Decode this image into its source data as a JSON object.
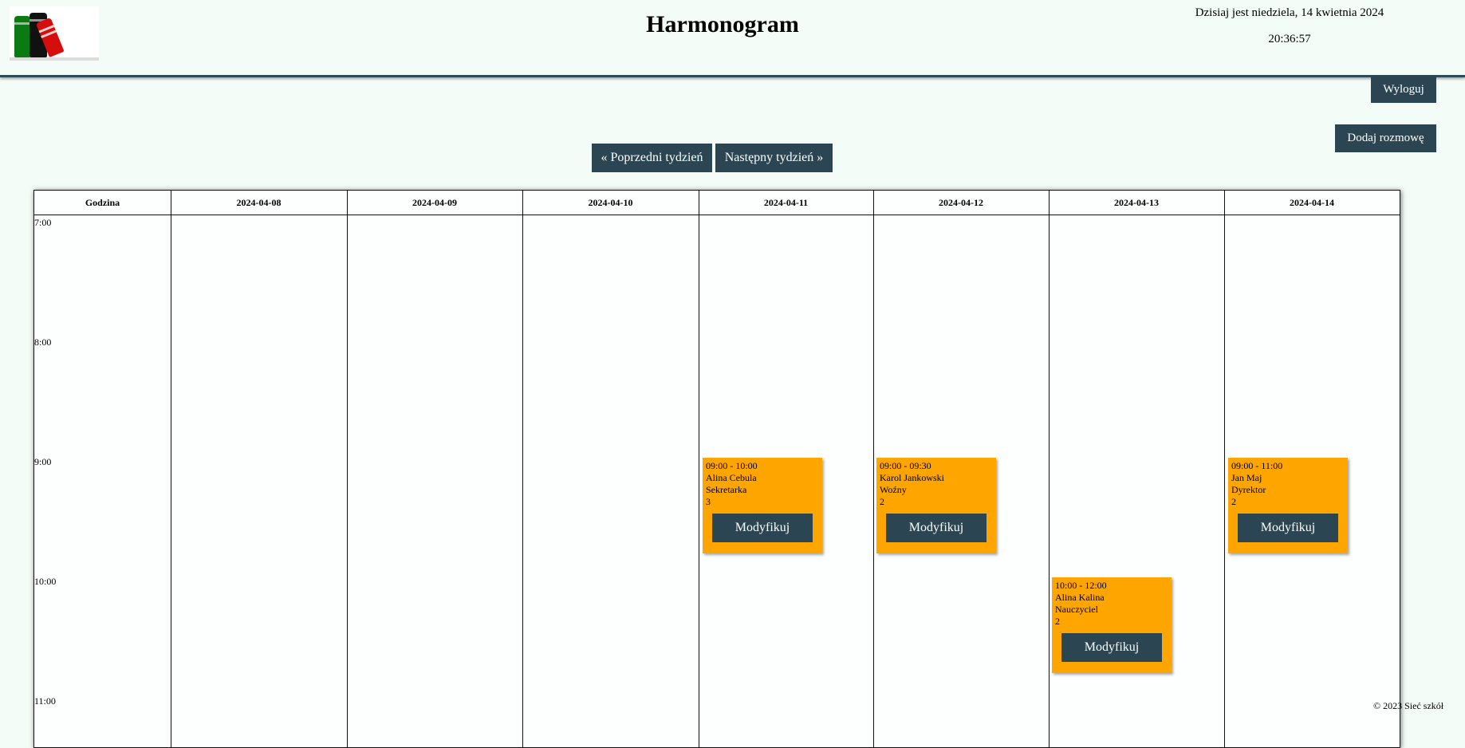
{
  "header": {
    "title": "Harmonogram",
    "date": "Dzisiaj jest niedziela, 14 kwietnia 2024",
    "time": "20:36:57"
  },
  "buttons": {
    "logout": "Wyloguj",
    "add_conversation": "Dodaj rozmowę",
    "prev_week": "« Poprzedni tydzień",
    "next_week": "Następny tydzień »"
  },
  "table": {
    "hour_header": "Godzina",
    "days": [
      "2024-04-08",
      "2024-04-09",
      "2024-04-10",
      "2024-04-11",
      "2024-04-12",
      "2024-04-13",
      "2024-04-14"
    ],
    "hours": [
      "7:00",
      "8:00",
      "9:00",
      "10:00",
      "11:00"
    ]
  },
  "events": [
    {
      "time": "09:00 - 10:00",
      "name": "Alina Cebula",
      "role": "Sekretarka",
      "count": "3",
      "button": "Modyfikuj"
    },
    {
      "time": "09:00 - 09:30",
      "name": "Karol Jankowski",
      "role": "Woźny",
      "count": "2",
      "button": "Modyfikuj"
    },
    {
      "time": "10:00 - 12:00",
      "name": "Alina Kalina",
      "role": "Nauczyciel",
      "count": "2",
      "button": "Modyfikuj"
    },
    {
      "time": "09:00 - 11:00",
      "name": "Jan Maj",
      "role": "Dyrektor",
      "count": "2",
      "button": "Modyfikuj"
    }
  ],
  "footer": "© 2023 Sieć szkół"
}
